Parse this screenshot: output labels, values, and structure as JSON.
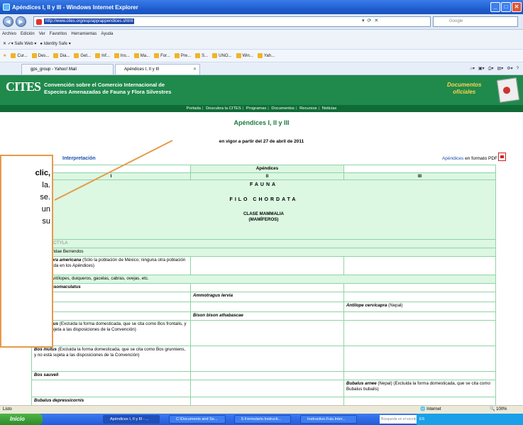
{
  "window": {
    "title": "Apéndices I, II y III - Windows Internet Explorer",
    "url": "http://www.cites.org/esp/app/appendices.shtml",
    "search_placeholder": "Google"
  },
  "menu": [
    "Archivo",
    "Edición",
    "Ver",
    "Favoritos",
    "Herramientas",
    "Ayuda"
  ],
  "toolbar": {
    "safeweb": "Safe Web",
    "identity": "Identity Safe"
  },
  "favorites": [
    "Cur...",
    "Des...",
    "Dia...",
    "Get...",
    "Inf...",
    "Ins...",
    "Ma...",
    "For...",
    "Pre...",
    "S...",
    "UNO...",
    "Win...",
    "Yah..."
  ],
  "tabs": [
    {
      "label": "gps_group - Yahoo! Mail"
    },
    {
      "label": "Apéndices I, II y III"
    }
  ],
  "header": {
    "logo": "CITES",
    "title_line1": "Convención sobre el Comercio Internacional de",
    "title_line2": "Especies Amenazadas de Fauna y Flora Silvestres",
    "docs_line1": "Documentos",
    "docs_line2": "oficiales"
  },
  "sitenav": [
    "Portada",
    "Descubra la CITES",
    "Programas",
    "Documentos",
    "Recursos",
    "Noticias"
  ],
  "page": {
    "title": "Apéndices I, II y III",
    "subtitle": "en vigor a partir del 27 de abril de 2011",
    "interpretation_link": "Interpretación",
    "pdf_link": "Apéndices",
    "pdf_suffix": "en formato PDF"
  },
  "table": {
    "header": "Apéndices",
    "cols": [
      "I",
      "II",
      "III"
    ],
    "fauna": "FAUNA",
    "phylum": "FILO CHORDATA",
    "class_line1": "CLASE MAMMALIA",
    "class_line2": "(MAMÍFEROS)",
    "order": "ARTIODACTYLA",
    "family1": "Antilocapridae Berrendos",
    "sp1_name": "Antilocapra americana",
    "sp1_note": "(Sólo la población de México; ninguna otra población está incluida en los Apéndices)",
    "family2": "Bovidae Antílopes, duiqueros, gacelas, cabras, ovejas, etc.",
    "sp2": "Addax nasomaculatus",
    "sp3": "Ammotragus lervia",
    "sp4_name": "Antilope cervicapra",
    "sp4_note": "(Nepal)",
    "sp5": "Bison bison athabascae",
    "sp6_name": "Bos gaurus",
    "sp6_note": "(Excluida la forma domesticada, que se cita como Bos frontalis, y no está sujeta a las disposiciones de la Convención)",
    "sp7_name": "Bos mutus",
    "sp7_note": "(Excluida la forma domesticada, que se cita como Bos grunniens, y no está sujeta a las disposiciones de la Convención)",
    "sp8": "Bos sauveli",
    "sp9_name": "Bubalus arnee",
    "sp9_note": "(Nepal) (Excluida la forma domesticada, que se cita como Bubalus bubalis)",
    "sp10": "Bubalus depressicornis"
  },
  "callout": {
    "lines": [
      "clic,",
      "la.",
      "se.",
      "un",
      "su"
    ]
  },
  "status": {
    "left": "Listo",
    "zone": "Internet",
    "zoom": "100%"
  },
  "taskbar": {
    "start": "Inicio",
    "tasks": [
      "Apéndices I, II y III - ...",
      "C:\\Documents and Se...",
      "5.Formulario.Instructi...",
      "Instructivo.Fuis.Inter..."
    ],
    "search": "Búsqueda en el escritorio",
    "tray": "ES"
  },
  "colors": {
    "header_green": "#1f8a4c",
    "title_green": "#1a7a3e",
    "table_border": "#8fd4a4",
    "callout_border": "#e69a4a"
  }
}
